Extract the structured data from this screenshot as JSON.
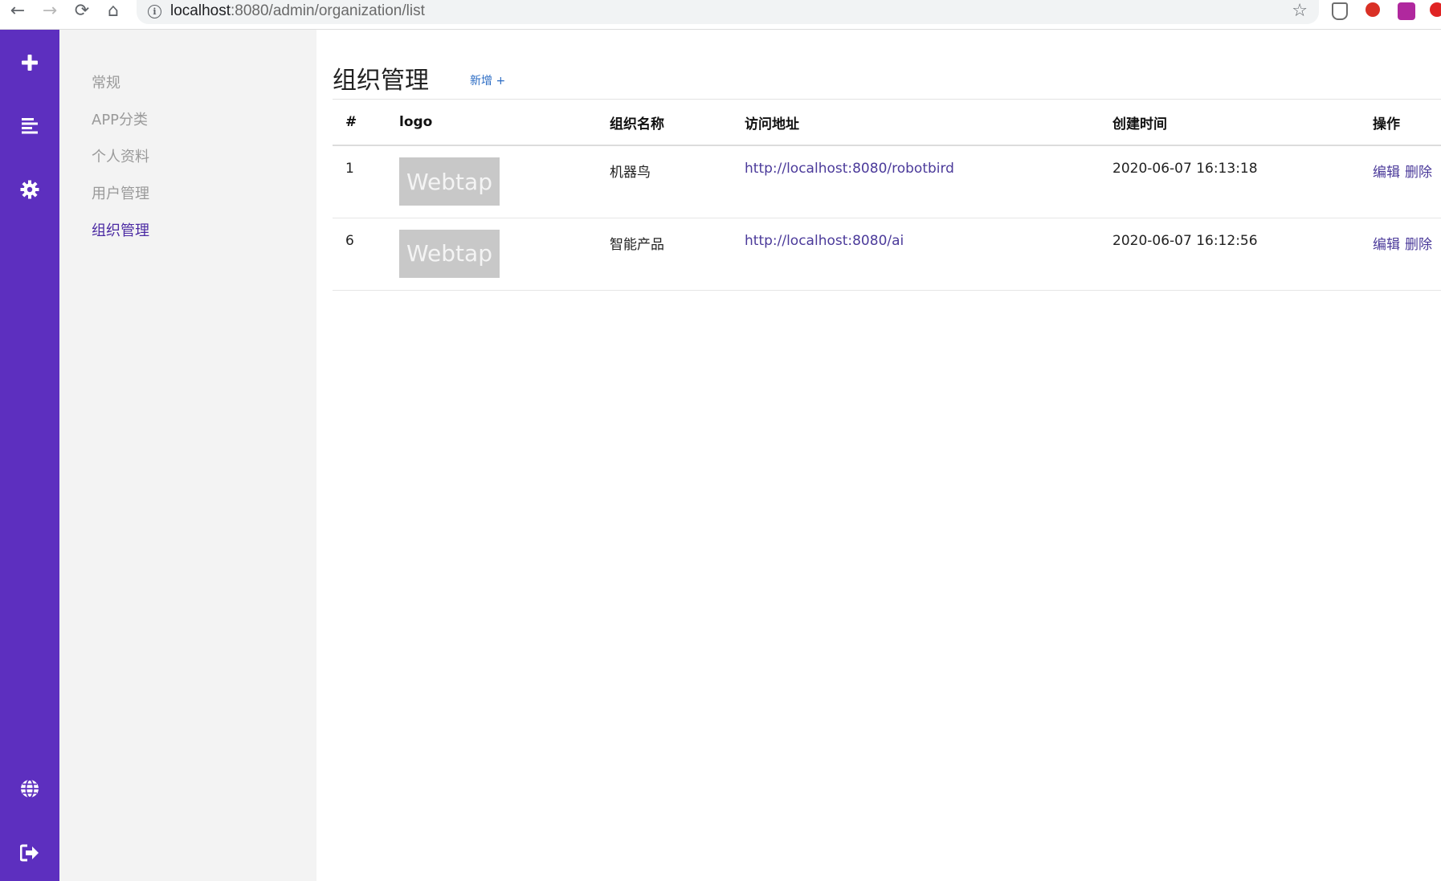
{
  "browser": {
    "url_host": "localhost",
    "url_path": ":8080/admin/organization/list"
  },
  "sidebar": {
    "items": [
      {
        "label": "常规"
      },
      {
        "label": "APP分类"
      },
      {
        "label": "个人资料"
      },
      {
        "label": "用户管理"
      },
      {
        "label": "组织管理"
      }
    ]
  },
  "main": {
    "title": "组织管理",
    "add_label": "新增 +",
    "columns": [
      "#",
      "logo",
      "组织名称",
      "访问地址",
      "创建时间",
      "操作"
    ],
    "rows": [
      {
        "id": "1",
        "logo_text": "Webtap",
        "name": "机器鸟",
        "url": "http://localhost:8080/robotbird",
        "created": "2020-06-07 16:13:18",
        "edit": "编辑",
        "delete": "删除"
      },
      {
        "id": "6",
        "logo_text": "Webtap",
        "name": "智能产品",
        "url": "http://localhost:8080/ai",
        "created": "2020-06-07 16:12:56",
        "edit": "编辑",
        "delete": "删除"
      }
    ]
  },
  "colors": {
    "rail": "#5d2fbf",
    "sidebar_bg": "#f3f3f3",
    "active_item": "#4b2aa3",
    "link": "#4b3a9a",
    "add_link": "#2b6cc4"
  },
  "icons": {
    "rail_top": [
      "plus-icon",
      "list-icon",
      "gear-icon"
    ],
    "rail_bottom": [
      "globe-icon",
      "logout-icon"
    ]
  }
}
